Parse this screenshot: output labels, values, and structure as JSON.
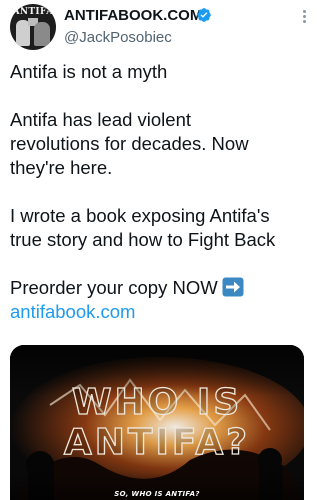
{
  "header": {
    "display_name": "ANTIFABOOK.COM",
    "handle": "@JackPosobiec",
    "avatar_text": "ANTIFA",
    "verified_icon": "verified-badge-icon",
    "more_icon": "more-vertical-icon",
    "accent_color": "#1d9bf0"
  },
  "tweet": {
    "paragraphs": [
      "Antifa is not a myth",
      "Antifa has lead violent\nrevolutions for decades. Now\nthey're here.",
      "I wrote a book exposing Antifa's\ntrue story and how to Fight Back"
    ],
    "cta_text": "Preorder your copy NOW",
    "cta_icon": "right-arrow-emoji-icon",
    "link": "antifabook.com"
  },
  "media": {
    "title_line1": "WHO IS",
    "title_line2": "ANTIFA?",
    "caption": "SO, WHO IS ANTIFA?"
  }
}
